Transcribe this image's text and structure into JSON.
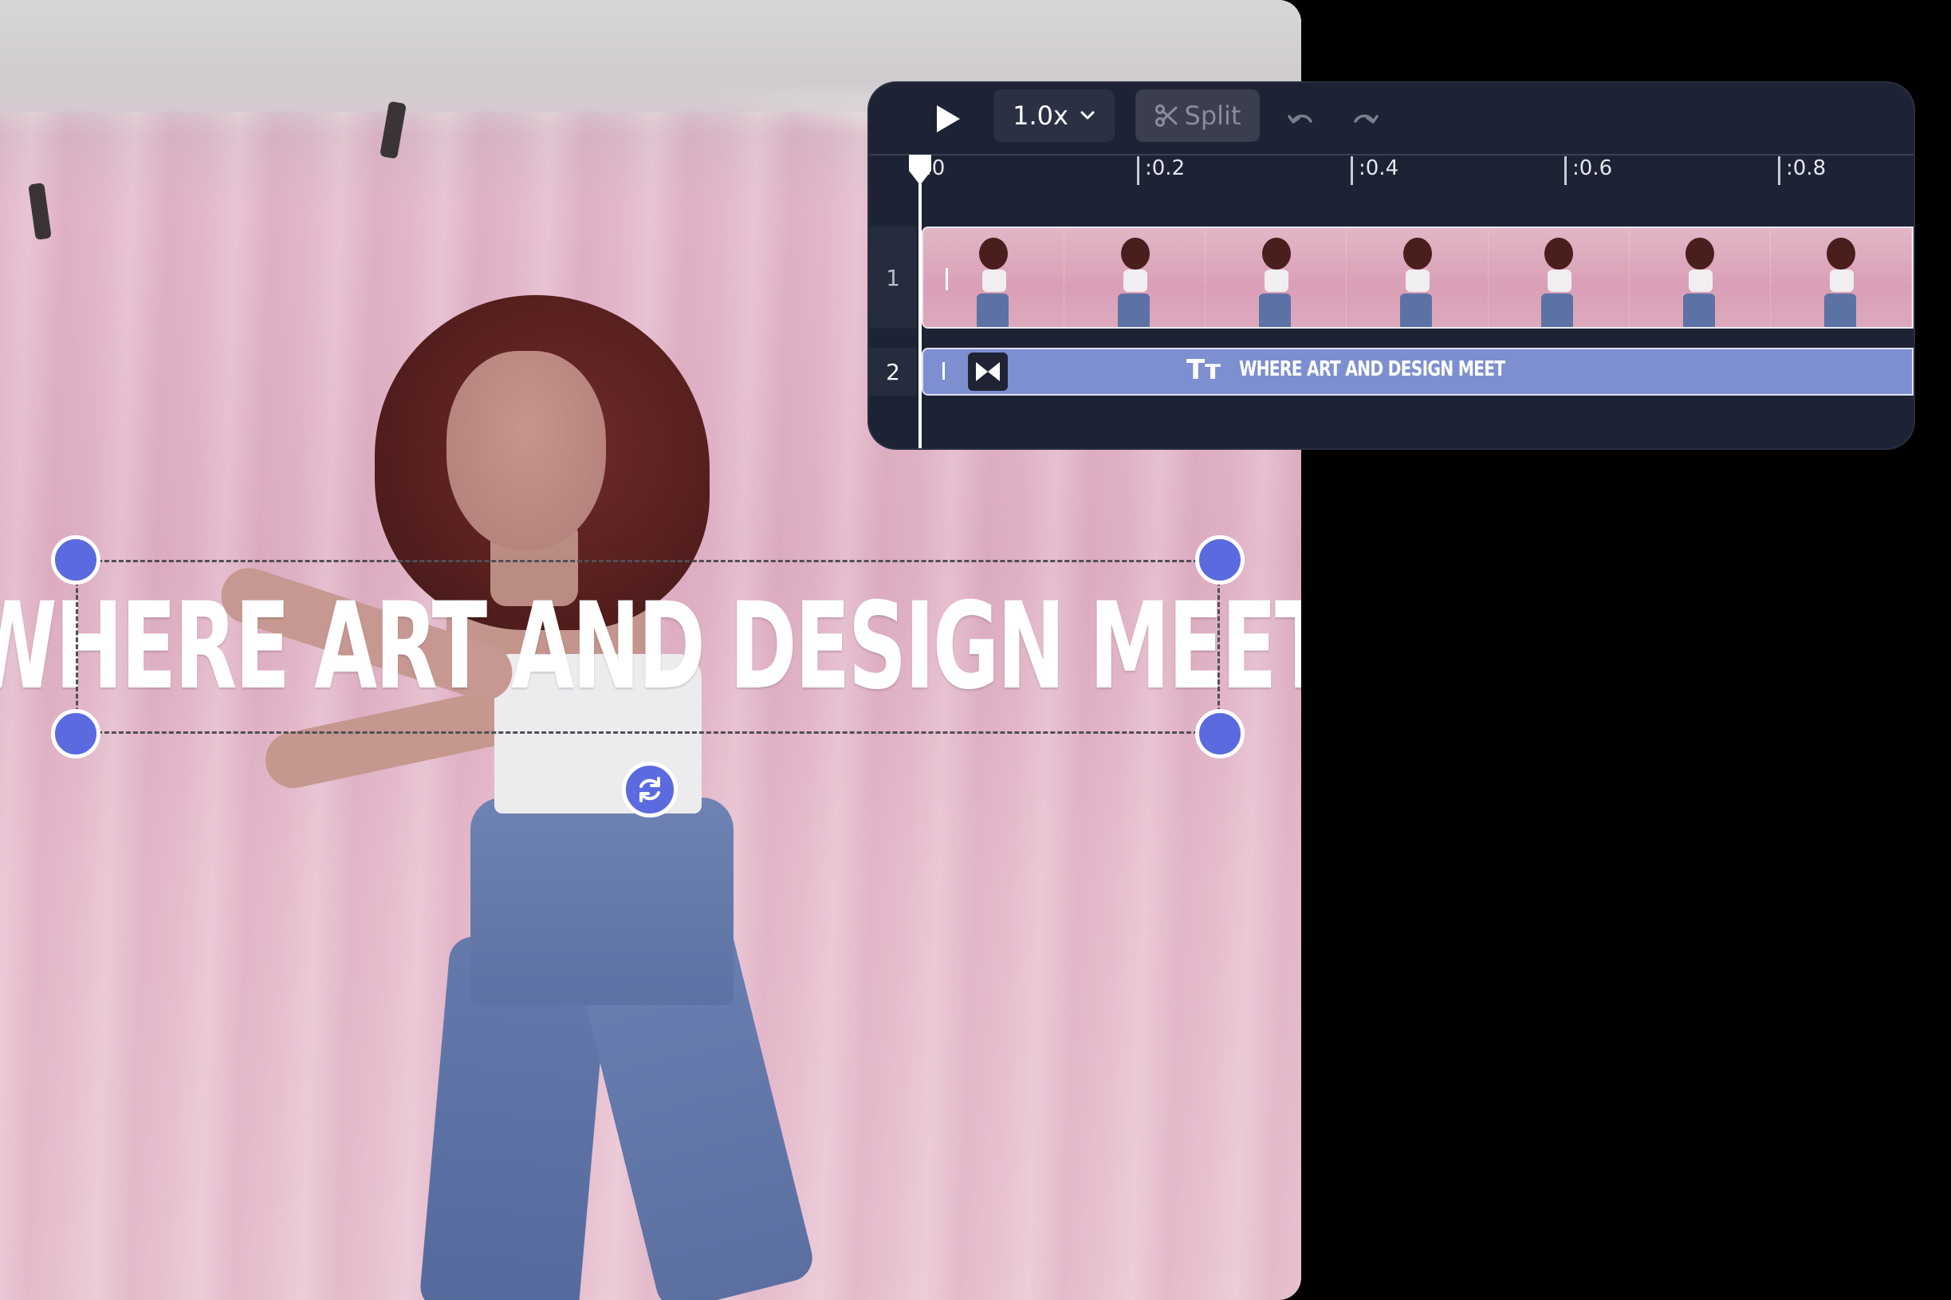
{
  "canvas": {
    "overlay_text": "WHERE ART AND DESIGN MEET"
  },
  "toolbar": {
    "play_icon": "play-icon",
    "speed_label": "1.0x",
    "speed_chevron": "chevron-down-icon",
    "split_label": "Split",
    "split_icon": "scissors-icon",
    "undo_icon": "undo-icon",
    "redo_icon": "redo-icon"
  },
  "ruler": {
    "ticks": [
      ":0",
      ":0.2",
      ":0.4",
      ":0.6",
      ":0.8"
    ]
  },
  "tracks": [
    {
      "number": "1",
      "type": "video"
    },
    {
      "number": "2",
      "type": "text",
      "label": "WHERE ART AND DESIGN MEET",
      "icon_label": "Tт"
    }
  ],
  "colors": {
    "accent": "#5b6adf",
    "panel_bg": "#1d2234",
    "text_track": "#7d8fd0"
  }
}
